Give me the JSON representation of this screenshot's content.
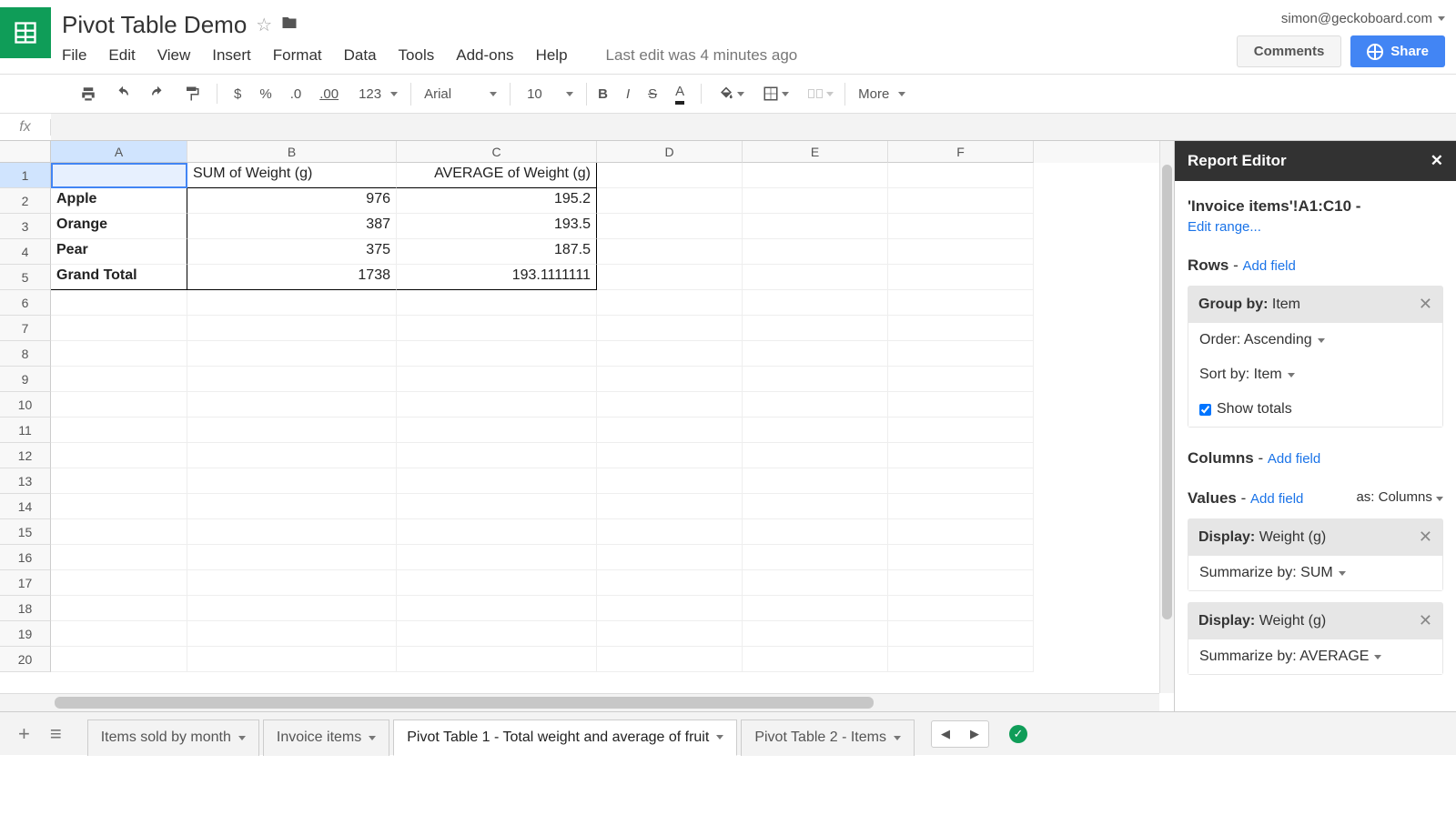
{
  "doc": {
    "title": "Pivot Table Demo",
    "last_edit": "Last edit was 4 minutes ago",
    "account": "simon@geckoboard.com"
  },
  "menus": [
    "File",
    "Edit",
    "View",
    "Insert",
    "Format",
    "Data",
    "Tools",
    "Add-ons",
    "Help"
  ],
  "buttons": {
    "comments": "Comments",
    "share": "Share"
  },
  "toolbar": {
    "font": "Arial",
    "font_size": "10",
    "num_fmt": "123",
    "dec_less": ".0",
    "dec_more": ".00",
    "more": "More"
  },
  "columns": [
    "A",
    "B",
    "C",
    "D",
    "E",
    "F"
  ],
  "pivot": {
    "b1": "SUM of Weight (g)",
    "c1": "AVERAGE of Weight (g)",
    "rows": [
      {
        "label": "Apple",
        "sum": "976",
        "avg": "195.2"
      },
      {
        "label": "Orange",
        "sum": "387",
        "avg": "193.5"
      },
      {
        "label": "Pear",
        "sum": "375",
        "avg": "187.5"
      },
      {
        "label": "Grand Total",
        "sum": "1738",
        "avg": "193.1111111"
      }
    ]
  },
  "panel": {
    "title": "Report Editor",
    "range": "'Invoice items'!A1:C10 -",
    "edit_range": "Edit range...",
    "rows_label": "Rows",
    "cols_label": "Columns",
    "vals_label": "Values",
    "add_field": "Add field",
    "as_columns": "as: Columns",
    "group_by_label": "Group by:",
    "group_by_value": "Item",
    "order_label": "Order: Ascending",
    "sort_by_label": "Sort by: Item",
    "show_totals": "Show totals",
    "display_label": "Display:",
    "display_value": "Weight (g)",
    "summarize1": "Summarize by: SUM",
    "summarize2": "Summarize by: AVERAGE"
  },
  "tabs": [
    {
      "label": "Items sold by month",
      "active": false
    },
    {
      "label": "Invoice items",
      "active": false
    },
    {
      "label": "Pivot Table 1 - Total weight and average of fruit",
      "active": true
    },
    {
      "label": "Pivot Table 2 - Items",
      "active": false
    }
  ]
}
